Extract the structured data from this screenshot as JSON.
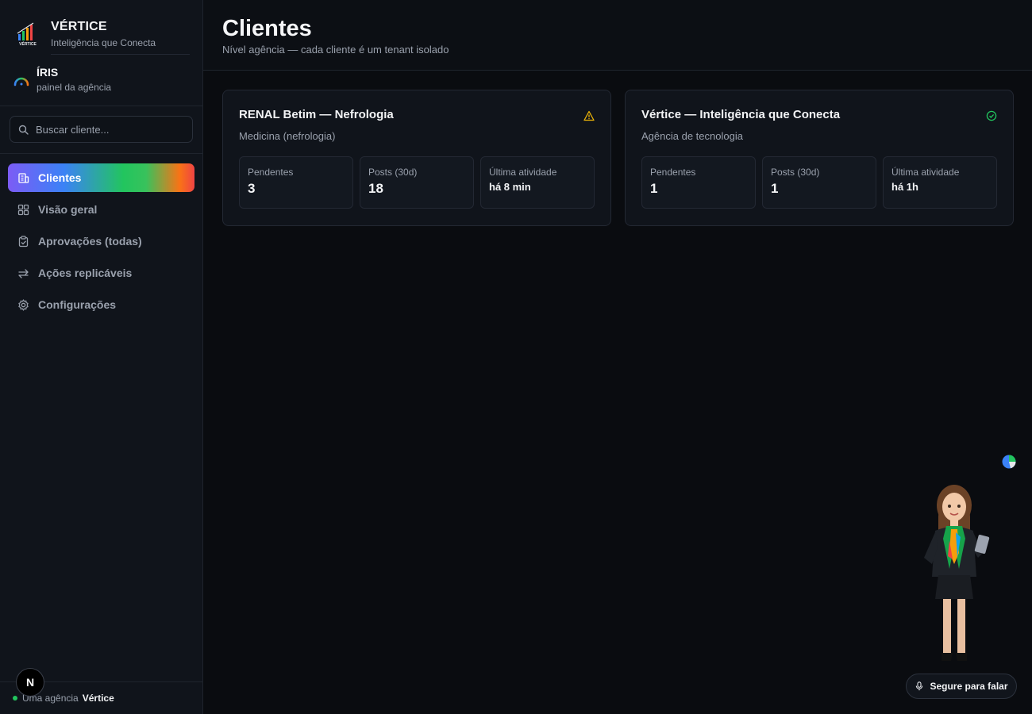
{
  "brand": {
    "name": "VÉRTICE",
    "tagline": "Inteligência que Conecta",
    "logo_text": "VÉRTICE"
  },
  "assistant": {
    "name": "ÍRIS",
    "subtitle": "painel da agência"
  },
  "search": {
    "placeholder": "Buscar cliente..."
  },
  "nav": {
    "items": [
      {
        "label": "Clientes",
        "icon": "building-icon",
        "active": true
      },
      {
        "label": "Visão geral",
        "icon": "grid-icon",
        "active": false
      },
      {
        "label": "Aprovações (todas)",
        "icon": "clipboard-check-icon",
        "active": false
      },
      {
        "label": "Ações replicáveis",
        "icon": "repeat-arrows-icon",
        "active": false
      },
      {
        "label": "Configurações",
        "icon": "gear-icon",
        "active": false
      }
    ]
  },
  "footer": {
    "prefix": "Uma agência",
    "agency": "Vértice",
    "badge": "N"
  },
  "page": {
    "title": "Clientes",
    "subtitle": "Nível agência — cada cliente é um tenant isolado"
  },
  "clients": [
    {
      "name": "RENAL Betim — Nefrologia",
      "segment": "Medicina (nefrologia)",
      "status_icon": "warning-icon",
      "status_color": "#eab308",
      "stats": [
        {
          "label": "Pendentes",
          "value": "3"
        },
        {
          "label": "Posts (30d)",
          "value": "18"
        },
        {
          "label": "Última atividade",
          "value": "há 8 min"
        }
      ]
    },
    {
      "name": "Vértice — Inteligência que Conecta",
      "segment": "Agência de tecnologia",
      "status_icon": "check-circle-icon",
      "status_color": "#22c55e",
      "stats": [
        {
          "label": "Pendentes",
          "value": "1"
        },
        {
          "label": "Posts (30d)",
          "value": "1"
        },
        {
          "label": "Última atividade",
          "value": "há 1h"
        }
      ]
    }
  ],
  "voice": {
    "label": "Segure para falar",
    "icon": "microphone-icon"
  },
  "colors": {
    "background": "#0a0c10",
    "sidebar": "#10141b",
    "active_gradient": [
      "#7c5cf5",
      "#3b82f6",
      "#22c55e",
      "#f97316",
      "#ef4444"
    ]
  }
}
